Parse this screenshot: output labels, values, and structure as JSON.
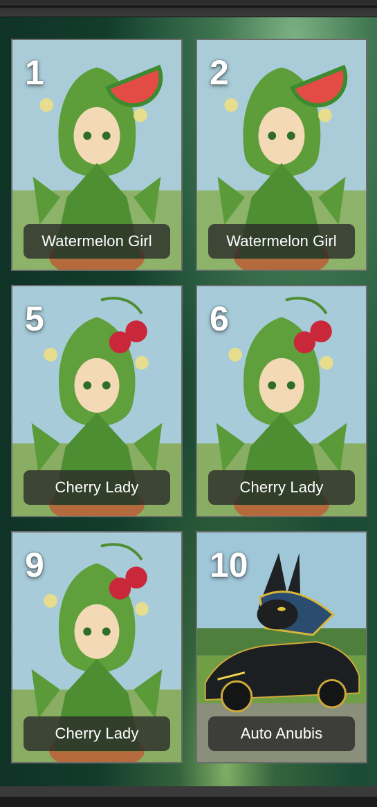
{
  "gallery": {
    "cards": [
      {
        "number": "1",
        "title": "Watermelon Girl",
        "art": "watermelon"
      },
      {
        "number": "2",
        "title": "Watermelon Girl",
        "art": "watermelon"
      },
      {
        "number": "5",
        "title": "Cherry Lady",
        "art": "cherry"
      },
      {
        "number": "6",
        "title": "Cherry Lady",
        "art": "cherry"
      },
      {
        "number": "9",
        "title": "Cherry Lady",
        "art": "cherry"
      },
      {
        "number": "10",
        "title": "Auto Anubis",
        "art": "anubis-car"
      }
    ]
  },
  "colors": {
    "panel_bg": "#14402f",
    "card_border": "#6b6b6b",
    "label_bg": "#282828",
    "label_text": "#ffffff"
  }
}
